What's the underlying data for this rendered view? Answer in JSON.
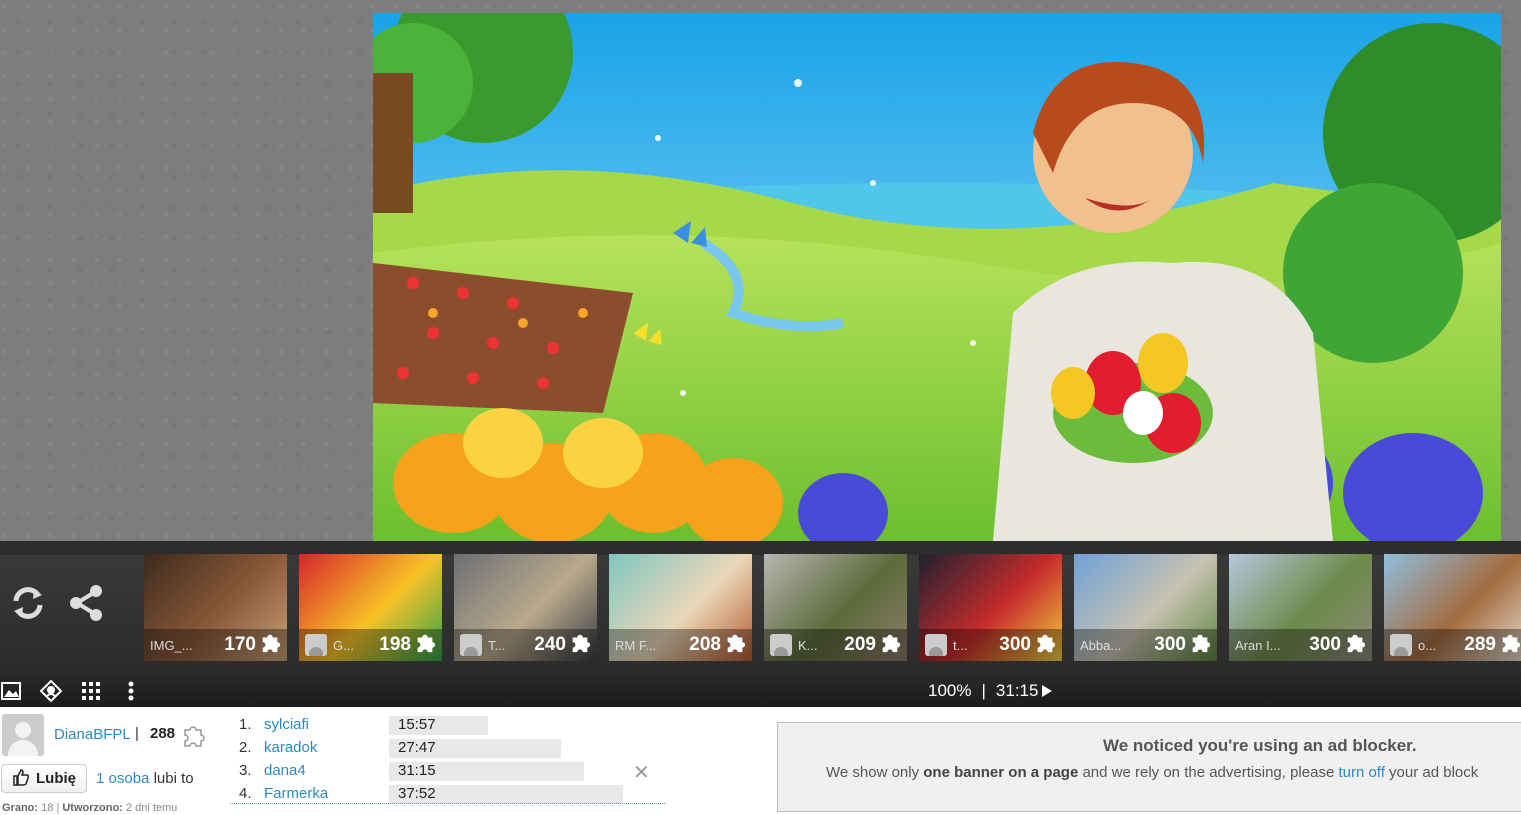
{
  "player": {
    "zoom": "100%",
    "separator": "|",
    "time": "31:15",
    "play_icon": "play-icon"
  },
  "sidebar_tools": [
    {
      "name": "refresh-icon"
    },
    {
      "name": "share-icon"
    }
  ],
  "toolbar_icons": [
    {
      "name": "image-icon"
    },
    {
      "name": "ghost-image-icon"
    },
    {
      "name": "grid-icon"
    },
    {
      "name": "more-vertical-icon"
    }
  ],
  "thumbnails": [
    {
      "label": "IMG_...",
      "pieces": "170",
      "avatar": false,
      "colors": [
        "#3d2a1c",
        "#8b5a3a",
        "#c9a27a"
      ]
    },
    {
      "label": "G...",
      "pieces": "198",
      "avatar": true,
      "colors": [
        "#d9232d",
        "#f7c326",
        "#2ea34a"
      ]
    },
    {
      "label": "T...",
      "pieces": "240",
      "avatar": true,
      "colors": [
        "#6d6f74",
        "#b9a98c",
        "#3a3d43"
      ]
    },
    {
      "label": "RM F...",
      "pieces": "208",
      "avatar": false,
      "colors": [
        "#7fc6c0",
        "#e9d7b8",
        "#b55b2e"
      ]
    },
    {
      "label": "K...",
      "pieces": "209",
      "avatar": true,
      "colors": [
        "#b7b5b0",
        "#5c6b3b",
        "#8e7d6a"
      ]
    },
    {
      "label": "t...",
      "pieces": "300",
      "avatar": true,
      "colors": [
        "#1f2130",
        "#c82c2c",
        "#f0d040"
      ]
    },
    {
      "label": "Abba...",
      "pieces": "300",
      "avatar": false,
      "colors": [
        "#6fa1d8",
        "#c8c2b2",
        "#5d8540"
      ]
    },
    {
      "label": "Aran I...",
      "pieces": "300",
      "avatar": false,
      "colors": [
        "#b5c8de",
        "#6d8a4a",
        "#8f8a7e"
      ]
    },
    {
      "label": "o...",
      "pieces": "289",
      "avatar": true,
      "colors": [
        "#8fbede",
        "#a36b3f",
        "#e7e1d3"
      ]
    }
  ],
  "user": {
    "name": "DianaBFPL",
    "separator": "|",
    "score": "288",
    "like_label": "Lubię",
    "like_count_link": "1 osoba",
    "like_suffix": "lubi to",
    "played_label": "Grano:",
    "played_value": "18",
    "created_label": "Utworzono:",
    "created_value": "2 dni temu",
    "meta_sep": "|"
  },
  "ranking": [
    {
      "rank": "1.",
      "name": "sylciafi",
      "time": "15:57",
      "bar": 0.3
    },
    {
      "rank": "2.",
      "name": "karadok",
      "time": "27:47",
      "bar": 0.52
    },
    {
      "rank": "3.",
      "name": "dana4",
      "time": "31:15",
      "bar": 0.59
    },
    {
      "rank": "4.",
      "name": "Farmerka",
      "time": "37:52",
      "bar": 0.71
    }
  ],
  "ranking_close": "✕",
  "adblock": {
    "title": "We noticed you're using an ad blocker.",
    "text_1": "We show only ",
    "text_bold": "one banner on a page",
    "text_2": " and we rely on the advertising, please ",
    "link": "turn off",
    "text_3": " your ad block"
  }
}
